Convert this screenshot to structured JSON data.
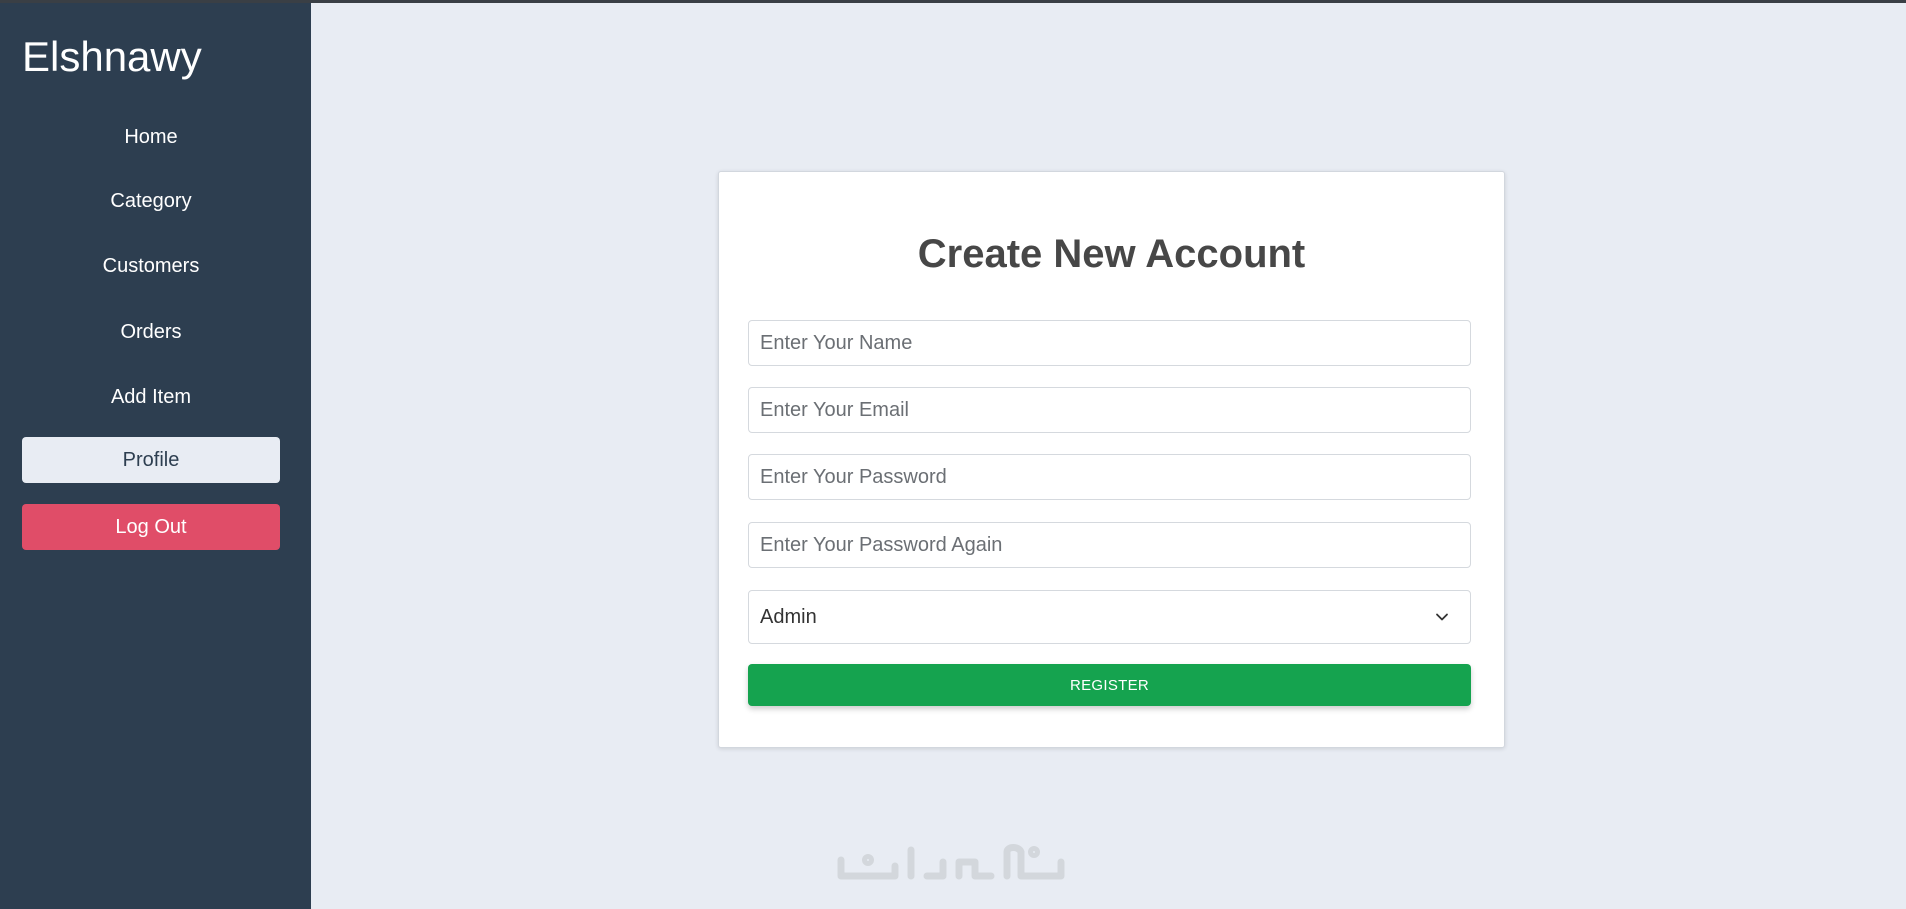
{
  "sidebar": {
    "brand": "Elshnawy",
    "items": [
      {
        "label": "Home"
      },
      {
        "label": "Category"
      },
      {
        "label": "Customers"
      },
      {
        "label": "Orders"
      },
      {
        "label": "Add Item"
      },
      {
        "label": "Profile"
      },
      {
        "label": "Log Out"
      }
    ]
  },
  "form": {
    "title": "Create New Account",
    "name_placeholder": "Enter Your Name",
    "email_placeholder": "Enter Your Email",
    "password_placeholder": "Enter Your Password",
    "password_again_placeholder": "Enter Your Password Again",
    "role_selected": "Admin",
    "register_label": "REGISTER"
  },
  "colors": {
    "sidebar_bg": "#2d3e50",
    "page_bg": "#e8ecf3",
    "logout": "#e04d68",
    "register": "#15a34f"
  },
  "watermark": {
    "text": "خمسات"
  }
}
